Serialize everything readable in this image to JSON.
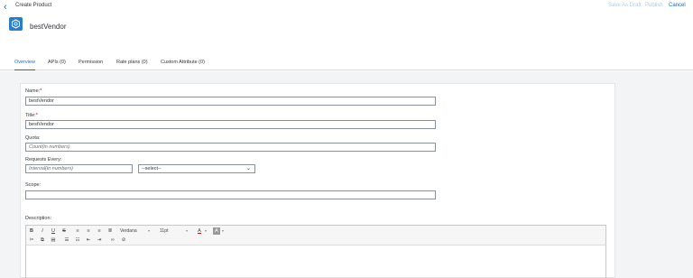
{
  "topbar": {
    "title": "Create Product",
    "actions": {
      "save_draft": "Save As Draft",
      "publish": "Publish",
      "cancel": "Cancel"
    }
  },
  "header": {
    "product_name": "bestVendor"
  },
  "tabs": [
    {
      "label": "Overview",
      "active": true
    },
    {
      "label": "APIs (0)"
    },
    {
      "label": "Permission"
    },
    {
      "label": "Rate plans (0)"
    },
    {
      "label": "Custom Attribute (0)"
    }
  ],
  "form": {
    "name": {
      "label": "Name:",
      "required": "*",
      "value": "bestVendor"
    },
    "title": {
      "label": "Title:",
      "required": "*",
      "value": "bestVendor"
    },
    "quota": {
      "label": "Quota:",
      "placeholder": "Count(in numbers)"
    },
    "requests_every": {
      "label": "Requests Every:",
      "placeholder": "Interval(in numbers)",
      "select_value": "--select--"
    },
    "scope": {
      "label": "Scope:",
      "value": ""
    },
    "description": {
      "label": "Description:",
      "font": "Verdana",
      "size": "11pt"
    }
  },
  "colors": {
    "accent": "#0a6ed1",
    "logo": "#2a7ec9",
    "required": "#bb0000"
  }
}
